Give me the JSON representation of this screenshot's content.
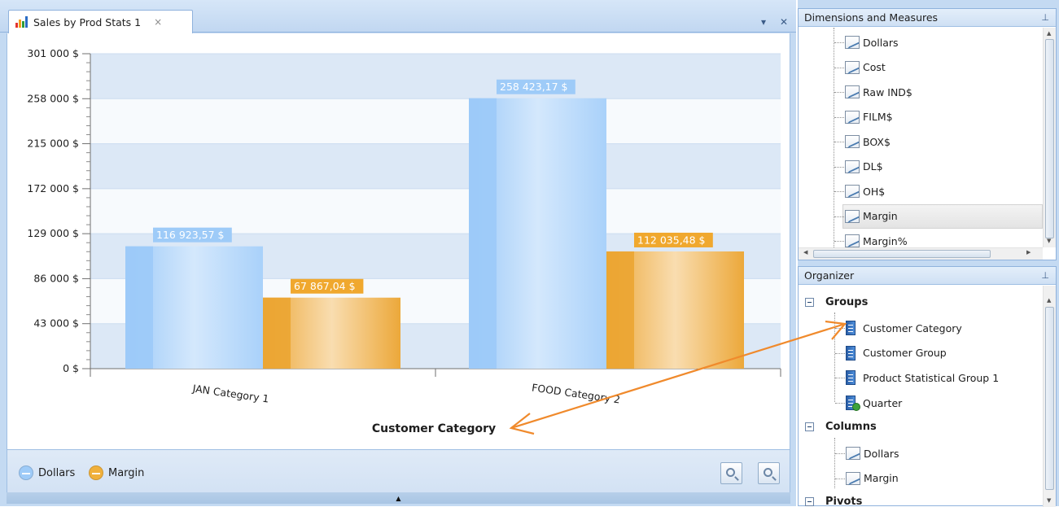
{
  "document": {
    "tab_title": "Sales by Prod Stats 1",
    "tab_close": "×",
    "menu_glyph": "▾",
    "close_glyph": "✕"
  },
  "chart_data": {
    "type": "bar",
    "categories": [
      "JAN Category 1",
      "FOOD Category 2"
    ],
    "series": [
      {
        "name": "Dollars",
        "values": [
          116923.57,
          258423.17
        ],
        "labels": [
          "116 923,57 $",
          "258 423,17 $"
        ],
        "color": "#9ecbf8"
      },
      {
        "name": "Margin",
        "values": [
          67867.04,
          112035.48
        ],
        "labels": [
          "67 867,04 $",
          "112 035,48 $"
        ],
        "color": "#f0b03b"
      }
    ],
    "xlabel": "Customer Category",
    "ylabel": "",
    "ylim": [
      0,
      301000
    ],
    "yticks": [
      0,
      43000,
      86000,
      129000,
      172000,
      215000,
      258000,
      301000
    ],
    "ytick_labels": [
      "0 $",
      "43 000 $",
      "86 000 $",
      "129 000 $",
      "172 000 $",
      "215 000 $",
      "258 000 $",
      "301 000 $"
    ],
    "grid": true,
    "legend": "bottom-left"
  },
  "legend": {
    "items": [
      {
        "label": "Dollars",
        "color": "#9ecbf8"
      },
      {
        "label": "Margin",
        "color": "#f0b03b"
      }
    ]
  },
  "zoom": {
    "out_icon": "zoom-out-icon",
    "in_icon": "zoom-in-icon"
  },
  "dimensions_panel": {
    "title": "Dimensions and Measures",
    "pin": "ф",
    "items": [
      "Dollars",
      "Cost",
      "Raw IND$",
      "FILM$",
      "BOX$",
      "DL$",
      "OH$",
      "Margin",
      "Margin%"
    ],
    "selected": "Margin"
  },
  "organizer_panel": {
    "title": "Organizer",
    "pin": "ф",
    "groups_label": "Groups",
    "groups": [
      "Customer Category",
      "Customer Group",
      "Product Statistical Group 1",
      "Quarter"
    ],
    "columns_label": "Columns",
    "columns": [
      "Dollars",
      "Margin"
    ],
    "pivots_label": "Pivots"
  },
  "colors": {
    "accent": "#f08a2c",
    "panel_bg": "#c4daf2"
  }
}
